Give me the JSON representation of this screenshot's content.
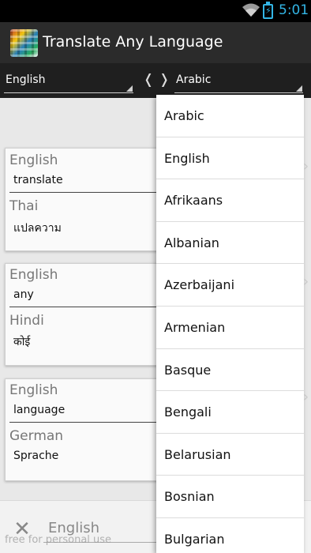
{
  "status": {
    "time": "5:01"
  },
  "app": {
    "title": "Translate Any Language"
  },
  "languages": {
    "source": "English",
    "target": "Arabic",
    "swap_left": "❬",
    "swap_right": "❭"
  },
  "cards": [
    {
      "src_lang": "English",
      "src_word": "translate",
      "dst_lang": "Thai",
      "dst_word": "แปลความ"
    },
    {
      "src_lang": "English",
      "src_word": "any",
      "dst_lang": "Hindi",
      "dst_word": "कोई"
    },
    {
      "src_lang": "English",
      "src_word": "language",
      "dst_lang": "German",
      "dst_word": "Sprache"
    }
  ],
  "input": {
    "value": "English"
  },
  "watermark": "free for personal use",
  "dropdown": {
    "options": [
      "Arabic",
      "English",
      "Afrikaans",
      "Albanian",
      "Azerbaijani",
      "Armenian",
      "Basque",
      "Bengali",
      "Belarusian",
      "Bosnian",
      "Bulgarian"
    ]
  },
  "icons": {
    "clear": "close-icon",
    "app": "flags-logo-icon",
    "wifi": "wifi-icon",
    "battery": "battery-charging-icon"
  },
  "colors": {
    "accent": "#33b5e5",
    "actionbar": "#2b2b2b",
    "langbar": "#1f1f1f"
  }
}
